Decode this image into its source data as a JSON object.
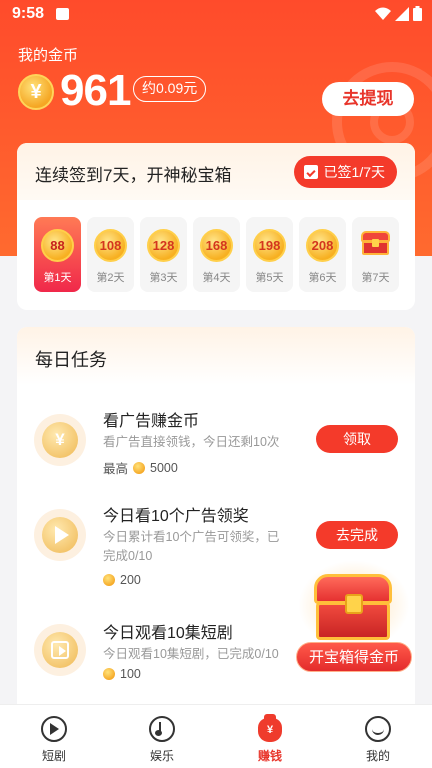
{
  "status_bar": {
    "time": "9:58"
  },
  "balance": {
    "label": "我的金币",
    "coin_symbol": "¥",
    "amount": "961",
    "yuan": "约0.09元",
    "withdraw_label": "去提现"
  },
  "signin": {
    "title": "连续签到7天，开神秘宝箱",
    "signed_badge": "已签1/7天",
    "days": [
      {
        "reward": "88",
        "label": "第1天",
        "active": true
      },
      {
        "reward": "108",
        "label": "第2天",
        "active": false
      },
      {
        "reward": "128",
        "label": "第3天",
        "active": false
      },
      {
        "reward": "168",
        "label": "第4天",
        "active": false
      },
      {
        "reward": "198",
        "label": "第5天",
        "active": false
      },
      {
        "reward": "208",
        "label": "第6天",
        "active": false
      },
      {
        "reward": "",
        "label": "第7天",
        "active": false,
        "icon": "treasure-chest-icon"
      }
    ]
  },
  "tasks": {
    "title": "每日任务",
    "items": [
      {
        "title": "看广告赚金币",
        "desc": "看广告直接领钱，今日还剩10次",
        "reward_prefix": "最高",
        "reward": "5000",
        "button": "领取",
        "icon": "yen-coin-icon"
      },
      {
        "title": "今日看10个广告领奖",
        "desc": "今日累计看10个广告可领奖，已完成0/10",
        "reward_prefix": "",
        "reward": "200",
        "button": "去完成",
        "icon": "play-icon"
      },
      {
        "title": "今日观看10集短剧",
        "desc": "今日观看10集短剧，已完成0/10",
        "reward_prefix": "",
        "reward": "100",
        "button": "",
        "icon": "video-play-icon"
      }
    ]
  },
  "floating_chest": {
    "label": "开宝箱得金币"
  },
  "bottom_nav": [
    {
      "label": "短剧",
      "icon": "play-circle-icon",
      "active": false
    },
    {
      "label": "娱乐",
      "icon": "music-note-icon",
      "active": false
    },
    {
      "label": "赚钱",
      "icon": "money-bag-icon",
      "active": true
    },
    {
      "label": "我的",
      "icon": "profile-icon",
      "active": false
    }
  ],
  "colors": {
    "primary": "#f43a2a",
    "hero": "#ff4b2b",
    "coin": "#f5a623"
  }
}
